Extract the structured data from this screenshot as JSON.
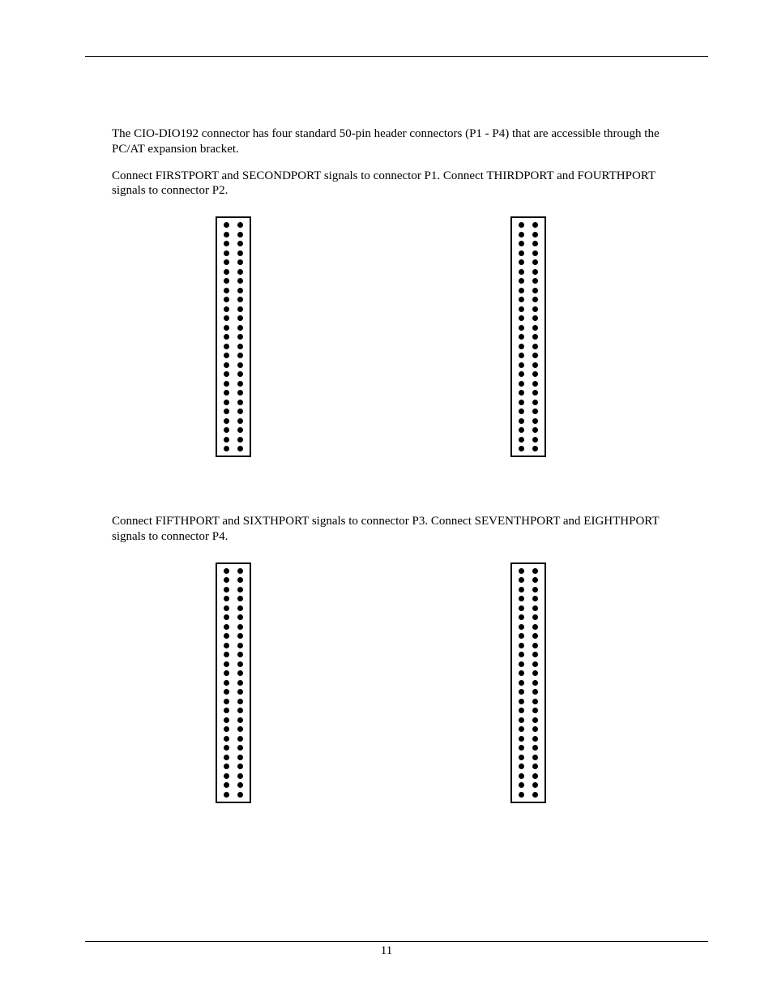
{
  "paragraphs": {
    "p1": "The CIO-DIO192 connector has four standard 50-pin header connectors (P1 - P4) that are accessible through the PC/AT expansion bracket.",
    "p2": "Connect FIRSTPORT and SECONDPORT signals to connector P1. Connect THIRDPORT and FOURTHPORT signals to connector P2.",
    "p3": "Connect FIFTHPORT and SIXTHPORT signals to connector P3. Connect SEVENTHPORT and EIGHTHPORT signals to connector P4."
  },
  "connectors": {
    "pin_rows": 25,
    "pins_per_row": 2,
    "count": 4
  },
  "page_number": "11"
}
